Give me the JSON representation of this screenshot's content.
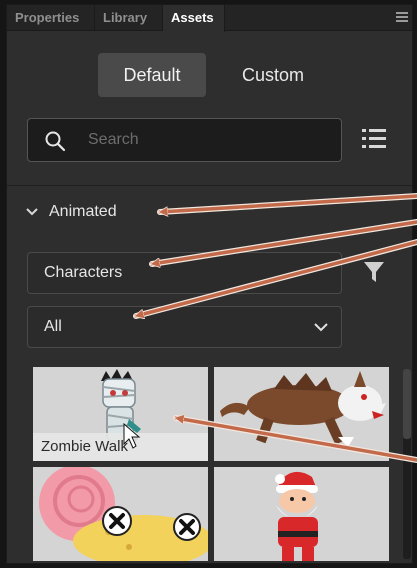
{
  "tabs": [
    {
      "label": "Properties",
      "active": false
    },
    {
      "label": "Library",
      "active": false
    },
    {
      "label": "Assets",
      "active": true
    }
  ],
  "toggle": {
    "default_label": "Default",
    "custom_label": "Custom",
    "selected": "Default"
  },
  "search": {
    "placeholder": "Search",
    "value": ""
  },
  "section": {
    "label": "Animated",
    "expanded": true
  },
  "filters": {
    "category": "Characters",
    "subcategory": "All"
  },
  "assets": [
    {
      "label": "Zombie Walk",
      "kind": "zombie",
      "hovered": true
    },
    {
      "label": "",
      "kind": "wolf",
      "hovered": false
    },
    {
      "label": "",
      "kind": "snail",
      "hovered": false
    },
    {
      "label": "",
      "kind": "santa",
      "hovered": false
    }
  ],
  "colors": {
    "panel_bg": "#2e2e2e",
    "arrow": "#c26a4a",
    "thumb_bg": "#d4d4d4",
    "selected_toggle": "#4a4a4a"
  },
  "icons": [
    "panel-menu-icon",
    "search-icon",
    "list-view-icon",
    "chevron-down-icon",
    "filter-icon"
  ]
}
